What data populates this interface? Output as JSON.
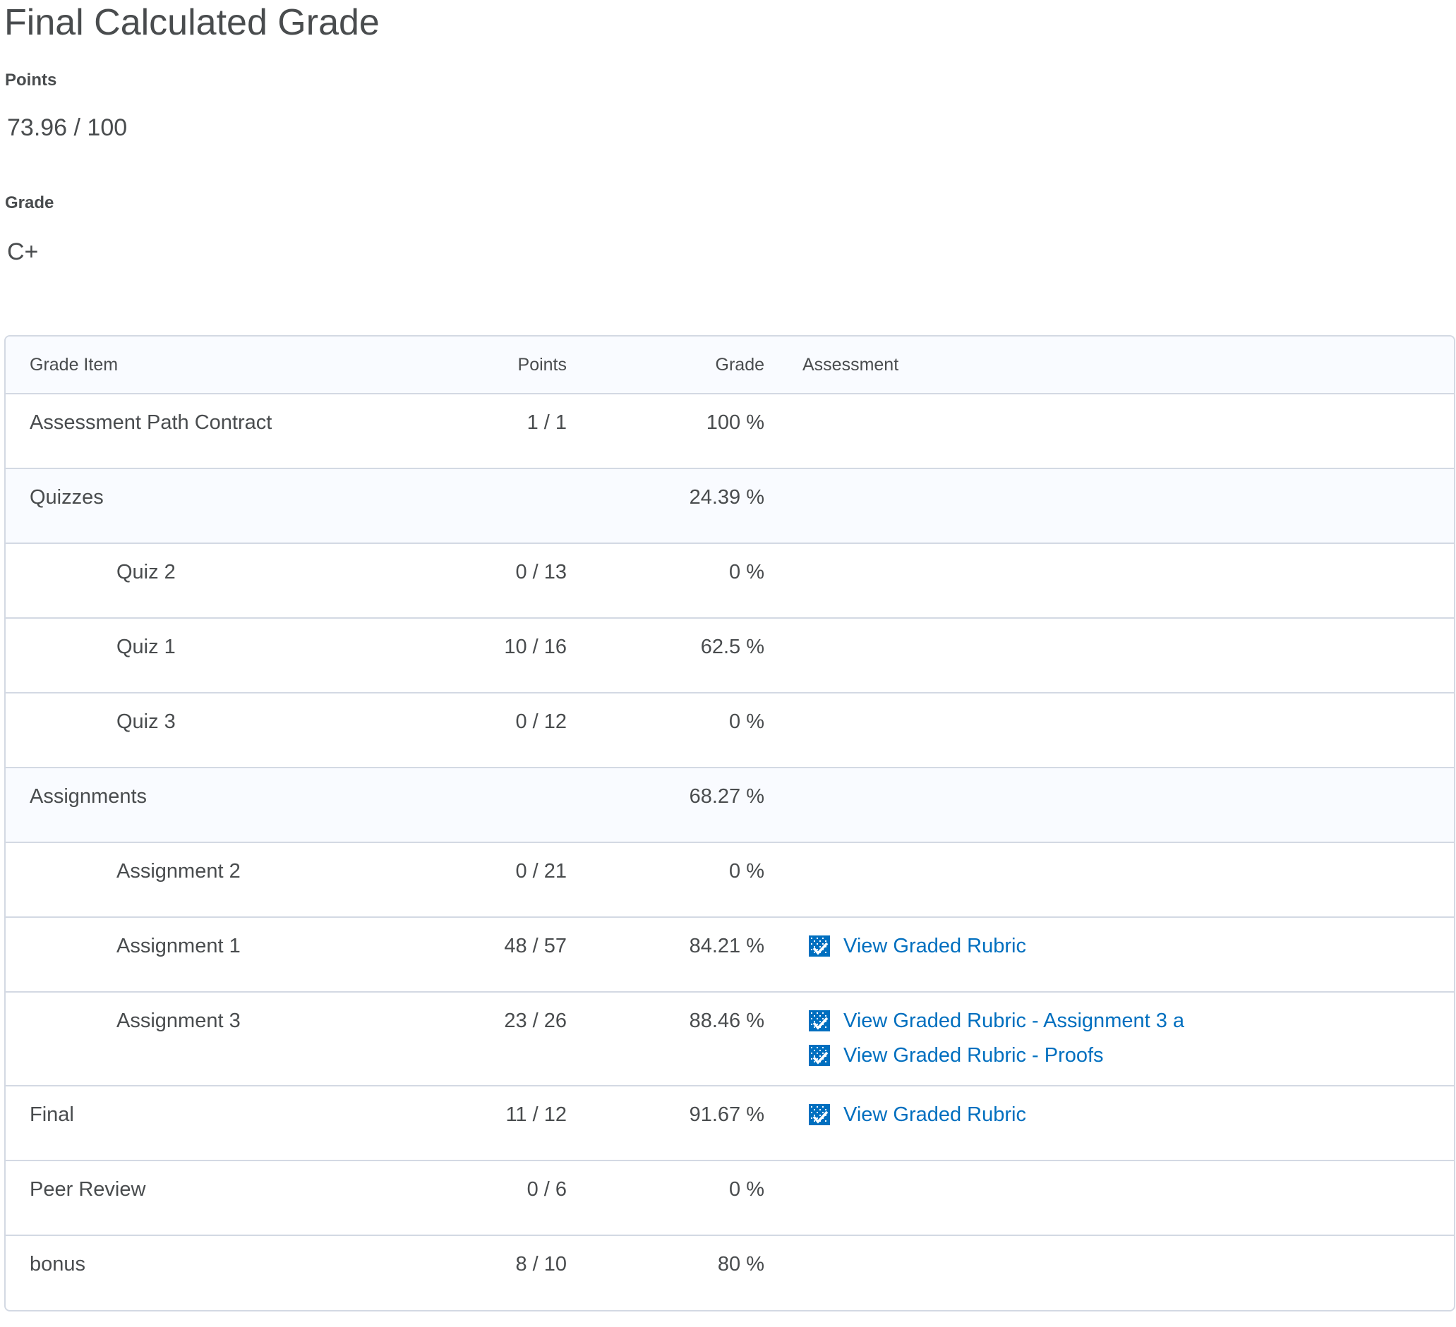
{
  "page": {
    "title": "Final Calculated Grade"
  },
  "summary": {
    "points_label": "Points",
    "points_value": "73.96 / 100",
    "grade_label": "Grade",
    "grade_value": "C+"
  },
  "table": {
    "headers": {
      "item": "Grade Item",
      "points": "Points",
      "grade": "Grade",
      "assessment": "Assessment"
    },
    "rows": [
      {
        "item": "Assessment Path Contract",
        "points": "1 / 1",
        "grade": "100 %",
        "type": "item",
        "links": []
      },
      {
        "item": "Quizzes",
        "points": "",
        "grade": "24.39 %",
        "type": "category",
        "links": []
      },
      {
        "item": "Quiz 2",
        "points": "0 / 13",
        "grade": "0 %",
        "type": "child",
        "links": []
      },
      {
        "item": "Quiz 1",
        "points": "10 / 16",
        "grade": "62.5 %",
        "type": "child",
        "links": []
      },
      {
        "item": "Quiz 3",
        "points": "0 / 12",
        "grade": "0 %",
        "type": "child",
        "links": []
      },
      {
        "item": "Assignments",
        "points": "",
        "grade": "68.27 %",
        "type": "category",
        "links": []
      },
      {
        "item": "Assignment 2",
        "points": "0 / 21",
        "grade": "0 %",
        "type": "child",
        "links": []
      },
      {
        "item": "Assignment 1",
        "points": "48 / 57",
        "grade": "84.21 %",
        "type": "child",
        "links": [
          "View Graded Rubric"
        ]
      },
      {
        "item": "Assignment 3",
        "points": "23 / 26",
        "grade": "88.46 %",
        "type": "child",
        "links": [
          "View Graded Rubric - Assignment 3 a",
          "View Graded Rubric - Proofs"
        ]
      },
      {
        "item": "Final",
        "points": "11 / 12",
        "grade": "91.67 %",
        "type": "item",
        "links": [
          "View Graded Rubric"
        ]
      },
      {
        "item": "Peer Review",
        "points": "0 / 6",
        "grade": "0 %",
        "type": "item",
        "links": []
      },
      {
        "item": "bonus",
        "points": "8 / 10",
        "grade": "80 %",
        "type": "item",
        "links": []
      }
    ]
  },
  "icons": {
    "rubric": "rubric-icon"
  },
  "colors": {
    "text": "#494c4e",
    "link": "#006fbf",
    "border": "#d3d9e3",
    "category_background": "#f9fbff"
  }
}
